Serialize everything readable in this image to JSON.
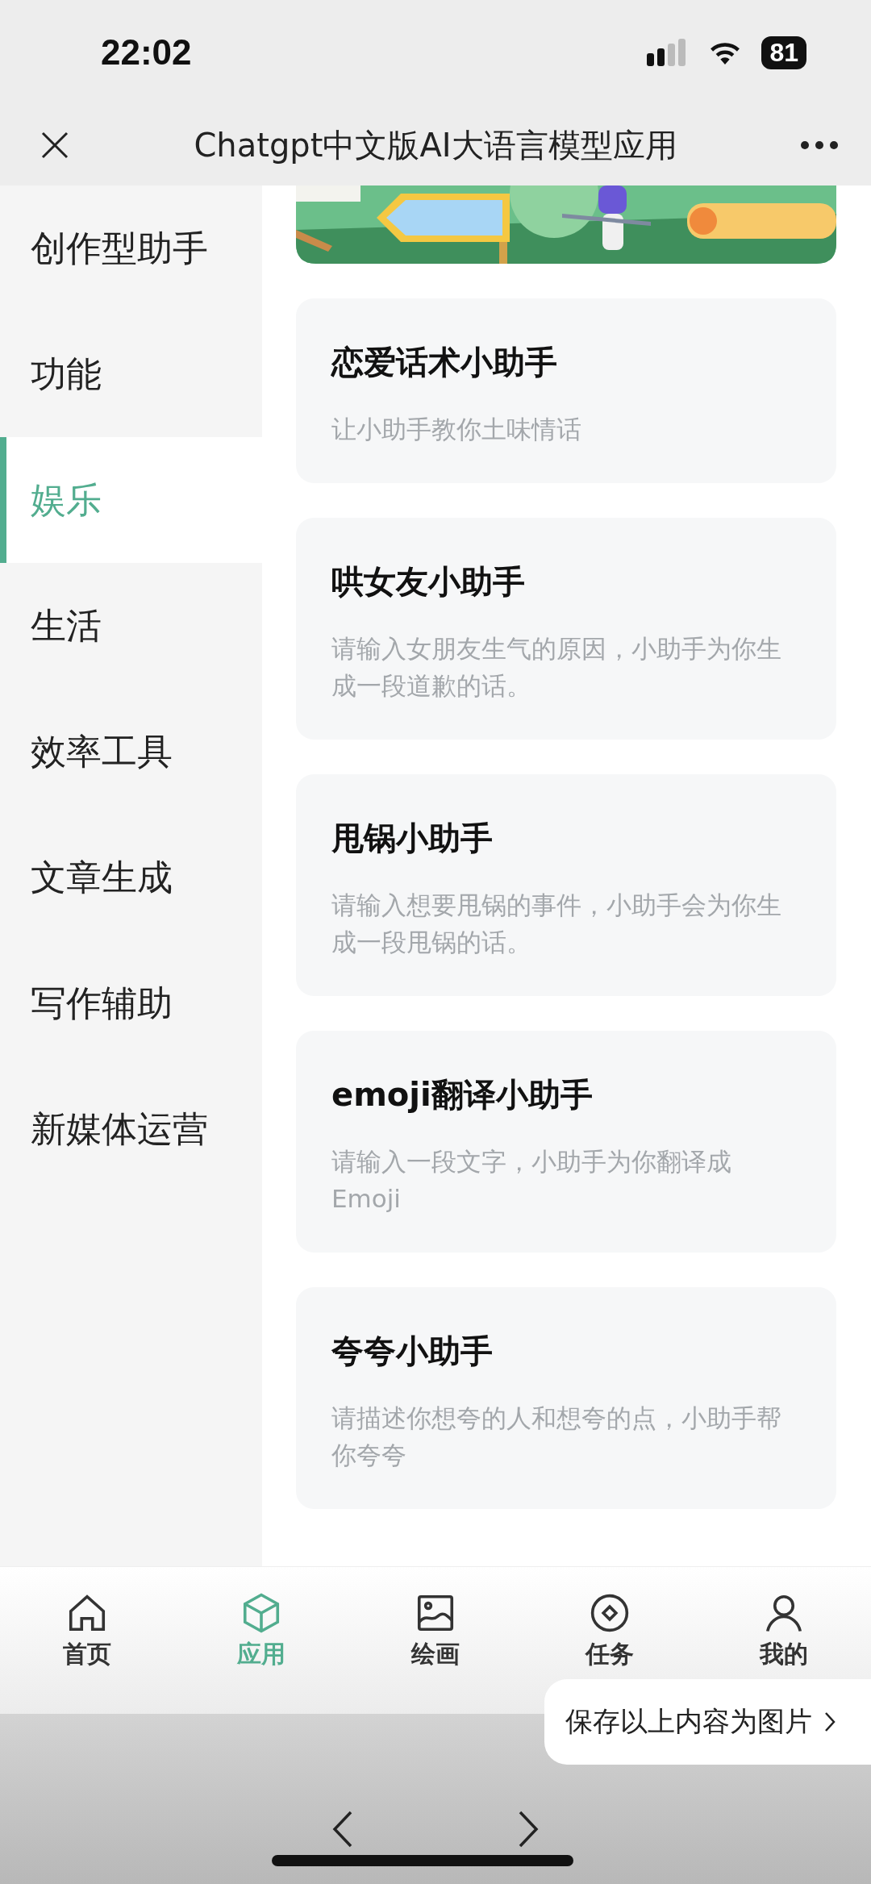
{
  "status_bar": {
    "time": "22:02",
    "battery": "81"
  },
  "nav_bar": {
    "title": "Chatgpt中文版AI大语言模型应用"
  },
  "sidebar": {
    "items": [
      {
        "label": "创作型助手",
        "selected": false
      },
      {
        "label": "功能",
        "selected": false
      },
      {
        "label": "娱乐",
        "selected": true
      },
      {
        "label": "生活",
        "selected": false
      },
      {
        "label": "效率工具",
        "selected": false
      },
      {
        "label": "文章生成",
        "selected": false
      },
      {
        "label": "写作辅助",
        "selected": false
      },
      {
        "label": "新媒体运营",
        "selected": false
      }
    ]
  },
  "cards": [
    {
      "title": "恋爱话术小助手",
      "description": "让小助手教你土味情话"
    },
    {
      "title": "哄女友小助手",
      "description": "请输入女朋友生气的原因，小助手为你生成一段道歉的话。"
    },
    {
      "title": "甩锅小助手",
      "description": "请输入想要甩锅的事件，小助手会为你生成一段甩锅的话。"
    },
    {
      "title": "emoji翻译小助手",
      "description": "请输入一段文字，小助手为你翻译成Emoji"
    },
    {
      "title": "夸夸小助手",
      "description": "请描述你想夸的人和想夸的点，小助手帮你夸夸"
    }
  ],
  "tab_bar": [
    {
      "label": "首页",
      "selected": false
    },
    {
      "label": "应用",
      "selected": true
    },
    {
      "label": "绘画",
      "selected": false
    },
    {
      "label": "任务",
      "selected": false
    },
    {
      "label": "我的",
      "selected": false
    }
  ],
  "save_popup": {
    "label": "保存以上内容为图片"
  }
}
